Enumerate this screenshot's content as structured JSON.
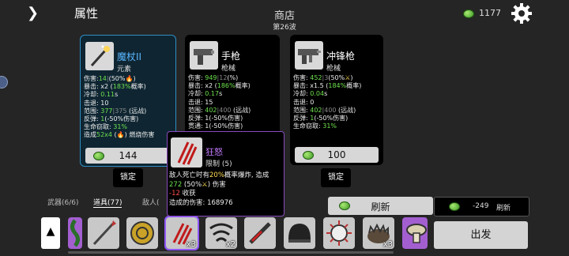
{
  "header": {
    "title": "属性",
    "shop_title": "商店",
    "wave": "第26波",
    "materials": "1177"
  },
  "cards": [
    {
      "name": "魔杖II",
      "subtitle": "元素",
      "price": "144",
      "lock": "锁定",
      "stats": [
        [
          {
            "t": "伤害:"
          },
          {
            "t": "14",
            "c": "g"
          },
          {
            "t": "|",
            "c": "gr"
          },
          {
            "t": "(50%"
          },
          {
            "t": "🔥",
            "c": "y"
          },
          {
            "t": ")"
          }
        ],
        [
          {
            "t": "暴击: x2 ("
          },
          {
            "t": "183%",
            "c": "g"
          },
          {
            "t": "概率)"
          }
        ],
        [
          {
            "t": "冷却: "
          },
          {
            "t": "0.11",
            "c": "g"
          },
          {
            "t": "s"
          }
        ],
        [
          {
            "t": "击退: 10"
          }
        ],
        [
          {
            "t": "范围: "
          },
          {
            "t": "377",
            "c": "g"
          },
          {
            "t": "|",
            "c": "gr"
          },
          {
            "t": "375",
            "c": "gr"
          },
          {
            "t": " (远战)"
          }
        ],
        [
          {
            "t": "反弹: "
          },
          {
            "t": "1",
            "c": "g"
          },
          {
            "t": "(-50%伤害)"
          }
        ],
        [
          {
            "t": "生命窃取: "
          },
          {
            "t": "31%",
            "c": "g"
          }
        ],
        [
          {
            "t": "造成"
          },
          {
            "t": "52x4",
            "c": "g"
          },
          {
            "t": " ("
          },
          {
            "t": "🔥",
            "c": "y"
          },
          {
            "t": ") 燃烧伤害"
          }
        ]
      ]
    },
    {
      "name": "手枪",
      "subtitle": "枪械",
      "stats": [
        [
          {
            "t": "伤害: "
          },
          {
            "t": "949",
            "c": "g"
          },
          {
            "t": "|",
            "c": "gr"
          },
          {
            "t": "12",
            "c": "gr"
          },
          {
            "t": "(%)"
          }
        ],
        [
          {
            "t": "暴击: x2 ("
          },
          {
            "t": "186%",
            "c": "g"
          },
          {
            "t": "概率)"
          }
        ],
        [
          {
            "t": "冷却: "
          },
          {
            "t": "0.17",
            "c": "g"
          },
          {
            "t": "s"
          }
        ],
        [
          {
            "t": "击退: 15"
          }
        ],
        [
          {
            "t": "范围: "
          },
          {
            "t": "402",
            "c": "g"
          },
          {
            "t": "|",
            "c": "gr"
          },
          {
            "t": "400",
            "c": "gr"
          },
          {
            "t": " (远战)"
          }
        ],
        [
          {
            "t": "反弹: 1(-50%伤害)"
          }
        ],
        [
          {
            "t": "贯通: 1(-50%伤害)"
          }
        ]
      ]
    },
    {
      "name": "冲锋枪",
      "subtitle": "枪械",
      "price": "100",
      "lock": "锁定",
      "stats": [
        [
          {
            "t": "伤害: "
          },
          {
            "t": "452",
            "c": "g"
          },
          {
            "t": "|",
            "c": "gr"
          },
          {
            "t": "3",
            "c": "gr"
          },
          {
            "t": "(50%"
          },
          {
            "t": "⚔",
            "c": "y"
          },
          {
            "t": ")"
          }
        ],
        [
          {
            "t": "暴击: x1.5 ("
          },
          {
            "t": "184%",
            "c": "g"
          },
          {
            "t": "概率)"
          }
        ],
        [
          {
            "t": "冷却: "
          },
          {
            "t": "0.04",
            "c": "g"
          },
          {
            "t": "s"
          }
        ],
        [
          {
            "t": "击退: 0"
          }
        ],
        [
          {
            "t": "范围: "
          },
          {
            "t": "402",
            "c": "g"
          },
          {
            "t": "|",
            "c": "gr"
          },
          {
            "t": "400",
            "c": "gr"
          },
          {
            "t": " (远战)"
          }
        ],
        [
          {
            "t": "反弹: "
          },
          {
            "t": "1",
            "c": "g"
          },
          {
            "t": "(-50%伤害)"
          }
        ],
        [
          {
            "t": "生命窃取: "
          },
          {
            "t": "31%",
            "c": "g"
          }
        ]
      ]
    }
  ],
  "tooltip": {
    "name": "狂怒",
    "subtitle": "限制 (5)",
    "lines": [
      [
        {
          "t": "敌人死亡时有"
        },
        {
          "t": "20%",
          "c": "y"
        },
        {
          "t": "概率爆炸, 造成"
        }
      ],
      [
        {
          "t": "272",
          "c": "g"
        },
        {
          "t": " (50%"
        },
        {
          "t": "⚔",
          "c": "y"
        },
        {
          "t": ") 伤害"
        }
      ],
      [
        {
          "t": "-12",
          "c": "r"
        },
        {
          "t": " 收获"
        }
      ],
      [
        {
          "t": "造成的伤害:  168976"
        }
      ]
    ]
  },
  "tabs": {
    "weapons": "武器(6/6)",
    "items": "道具(77)",
    "enemies": "敌人("
  },
  "refresh": {
    "label": "刷新",
    "cost": "-249",
    "alt_label": "刷新"
  },
  "go_label": "出发",
  "inventory": [
    {
      "icon": "vine-icon",
      "count": ""
    },
    {
      "icon": "spear-icon",
      "count": ""
    },
    {
      "icon": "shield-coin-icon",
      "count": ""
    },
    {
      "icon": "rage-claw-icon",
      "count": "x3"
    },
    {
      "icon": "tornado-icon",
      "count": "x2"
    },
    {
      "icon": "syringe-icon",
      "count": ""
    },
    {
      "icon": "helmet-icon",
      "count": ""
    },
    {
      "icon": "spiky-orb-icon",
      "count": ""
    },
    {
      "icon": "hedgehog-icon",
      "count": "x3"
    },
    {
      "icon": "mushroom-icon",
      "count": ""
    }
  ],
  "colors": {
    "accent_blue": "#2e8ec4",
    "tooltip_purple": "#8a4bbf",
    "stat_green": "#6ee04e"
  }
}
